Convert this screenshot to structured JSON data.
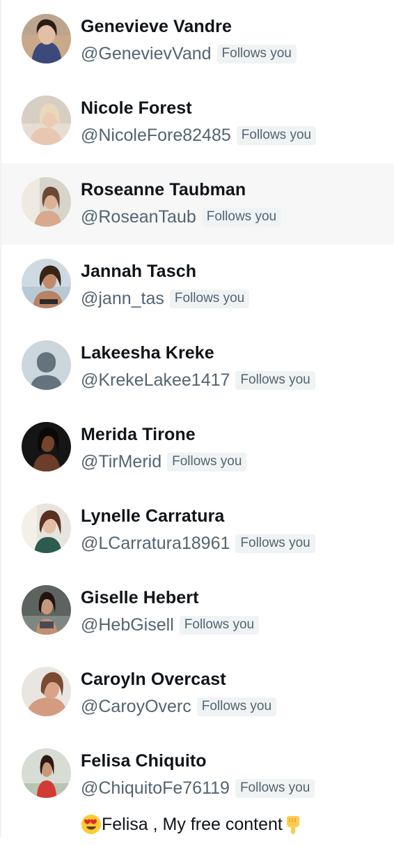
{
  "follows_you_label": "Follows you",
  "followers": [
    {
      "name": "Genevieve Vandre",
      "handle": "@GenevievVand"
    },
    {
      "name": "Nicole Forest",
      "handle": "@NicoleFore82485"
    },
    {
      "name": "Roseanne Taubman",
      "handle": "@RoseanTaub"
    },
    {
      "name": "Jannah Tasch",
      "handle": "@jann_tas"
    },
    {
      "name": "Lakeesha Kreke",
      "handle": "@KrekeLakee1417"
    },
    {
      "name": "Merida Tirone",
      "handle": "@TirMerid"
    },
    {
      "name": "Lynelle Carratura",
      "handle": "@LCarratura18961"
    },
    {
      "name": "Giselle Hebert",
      "handle": "@HebGisell"
    },
    {
      "name": "Caroyln Overcast",
      "handle": "@CaroyOverc"
    },
    {
      "name": "Felisa Chiquito",
      "handle": "@ChiquitoFe76119",
      "bio": "Felisa , My free content"
    }
  ],
  "colors": {
    "name_text": "#0f1419",
    "secondary_text": "#536471",
    "badge_bg": "#eff3f4",
    "hover_row_bg": "#f7f7f7"
  },
  "icons": {
    "default_avatar": "default-profile-icon",
    "bio_emoji_start": "heart-eyes-emoji-icon",
    "bio_emoji_end": "pointing-down-emoji-icon"
  }
}
